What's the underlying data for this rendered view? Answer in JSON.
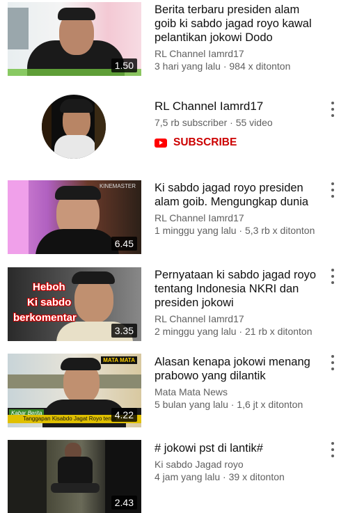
{
  "videos": [
    {
      "title": "Berita terbaru presiden alam goib ki sabdo jagad royo kawal pelantikan jokowi Dodo",
      "channel": "RL Channel Iamrd17",
      "stats": "3 hari yang lalu · 984 x ditonton",
      "duration": "1.50"
    },
    {
      "title": "Ki sabdo jagad royo presiden alam goib. Mengungkap dunia",
      "channel": "RL Channel Iamrd17",
      "stats": "1 minggu yang lalu · 5,3 rb x ditonton",
      "duration": "6.45",
      "watermark": "KINEMASTER"
    },
    {
      "title": "Pernyataan ki sabdo jagad royo tentang Indonesia NKRI dan presiden jokowi",
      "channel": "RL Channel Iamrd17",
      "stats": "2 minggu yang lalu · 21 rb x ditonton",
      "duration": "3.35",
      "overlay1": "Heboh",
      "overlay2": "Ki sabdo",
      "overlay3": "berkomentar"
    },
    {
      "title": "Alasan kenapa jokowi menang prabowo yang dilantik",
      "channel": "Mata Mata News",
      "stats": "5 bulan yang lalu · 1,6 jt x ditonton",
      "duration": "4.22",
      "logo": "MATA MATA",
      "banner_tag": "Kabar Berita",
      "banner": "Tanggapan Kisabdo Jagat Royo tenta"
    },
    {
      "title": "# jokowi pst di lantik#",
      "channel": "Ki sabdo Jagad royo",
      "stats": "4 jam yang lalu · 39 x ditonton",
      "duration": "2.43"
    }
  ],
  "channel_card": {
    "name": "RL Channel Iamrd17",
    "stats": "7,5 rb subscriber · 55 video",
    "subscribe_label": "SUBSCRIBE"
  },
  "colors": {
    "subscribe": "#cc0000",
    "text": "#0f0f0f",
    "meta": "#606060"
  }
}
